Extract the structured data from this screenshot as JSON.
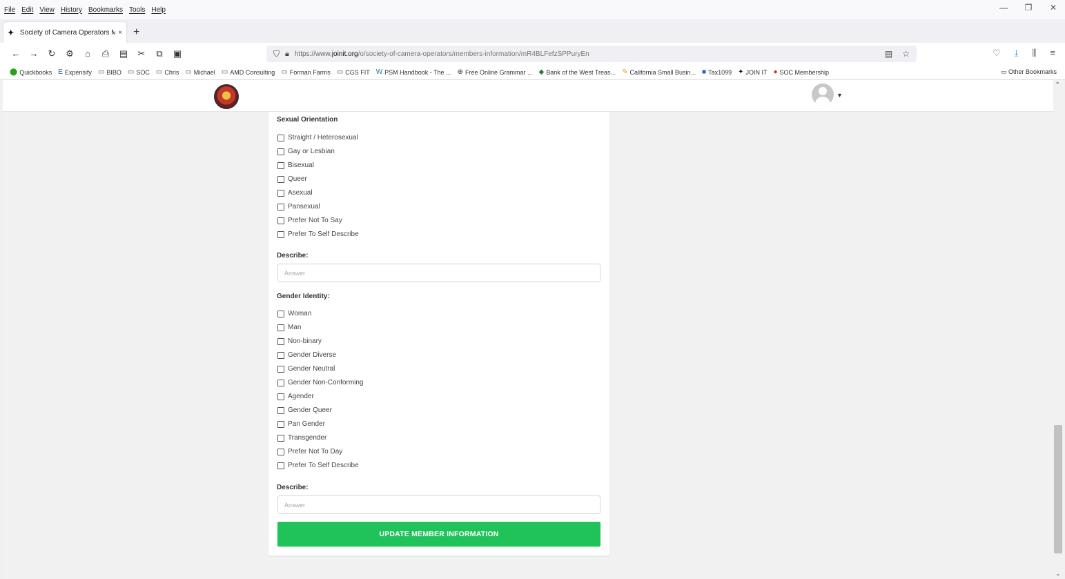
{
  "browser": {
    "menu": [
      "File",
      "Edit",
      "View",
      "History",
      "Bookmarks",
      "Tools",
      "Help"
    ],
    "tab": {
      "title": "Society of Camera Operators M",
      "close": "×"
    },
    "new_tab": "+",
    "url": {
      "prefix": "https://www.",
      "host": "joinit.org",
      "path": "/o/society-of-camera-operators/members-information/mR4BLFefzSPPuryEn"
    },
    "bookmarks": [
      {
        "icon": "⬤",
        "color": "#2ca01c",
        "label": "Quickbooks"
      },
      {
        "icon": "E",
        "color": "#1a5fb4",
        "label": "Expensify"
      },
      {
        "icon": "▭",
        "color": "#555555",
        "label": "BIBO"
      },
      {
        "icon": "▭",
        "color": "#555555",
        "label": "SOC"
      },
      {
        "icon": "▭",
        "color": "#555555",
        "label": "Chris"
      },
      {
        "icon": "▭",
        "color": "#555555",
        "label": "Michael"
      },
      {
        "icon": "▭",
        "color": "#555555",
        "label": "AMD Consulting"
      },
      {
        "icon": "▭",
        "color": "#555555",
        "label": "Forman Farms"
      },
      {
        "icon": "▭",
        "color": "#555555",
        "label": "CGS FIT"
      },
      {
        "icon": "W",
        "color": "#21759b",
        "label": "PSM Handbook - The ..."
      },
      {
        "icon": "⊕",
        "color": "#333333",
        "label": "Free Online Grammar ..."
      },
      {
        "icon": "◆",
        "color": "#2e7d32",
        "label": "Bank of the West Treas..."
      },
      {
        "icon": "✎",
        "color": "#f0a000",
        "label": "California Small Busin..."
      },
      {
        "icon": "■",
        "color": "#1565c0",
        "label": "Tax1099"
      },
      {
        "icon": "✦",
        "color": "#111111",
        "label": "JOIN IT"
      },
      {
        "icon": "●",
        "color": "#c0392b",
        "label": "SOC Membership"
      }
    ],
    "other_bookmarks": "Other Bookmarks"
  },
  "form": {
    "sexual_orientation": {
      "title": "Sexual Orientation",
      "options": [
        "Straight / Heterosexual",
        "Gay or Lesbian",
        "Bisexual",
        "Queer",
        "Asexual",
        "Pansexual",
        "Prefer Not To Say",
        "Prefer To Self Describe"
      ]
    },
    "describe_1": {
      "label": "Describe:",
      "placeholder": "Answer"
    },
    "gender_identity": {
      "title": "Gender Identity:",
      "options": [
        "Woman",
        "Man",
        "Non-binary",
        "Gender Diverse",
        "Gender Neutral",
        "Gender Non-Conforming",
        "Agender",
        "Gender Queer",
        "Pan Gender",
        "Transgender",
        "Prefer Not To Day",
        "Prefer To Self Describe"
      ]
    },
    "describe_2": {
      "label": "Describe:",
      "placeholder": "Answer"
    },
    "submit_label": "UPDATE MEMBER INFORMATION"
  }
}
